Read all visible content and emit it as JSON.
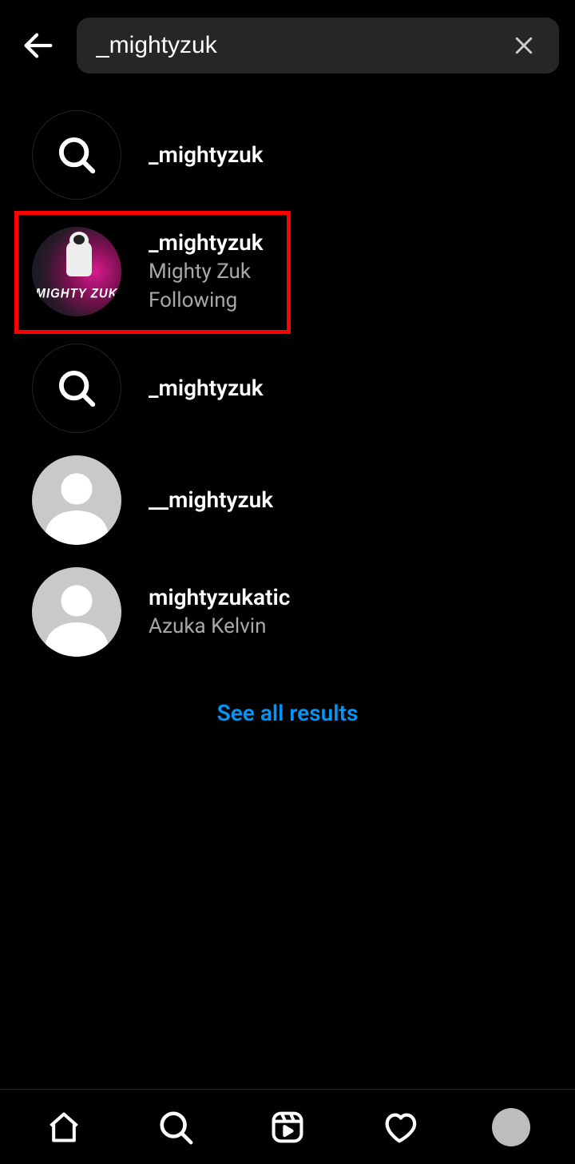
{
  "search": {
    "query": "_mightyzuk"
  },
  "results": [
    {
      "type": "query",
      "username": "_mightyzuk",
      "display_name": "",
      "status": ""
    },
    {
      "type": "profile",
      "username": "_mightyzuk",
      "display_name": "Mighty Zuk",
      "status": "Following",
      "avatar": "custom",
      "highlighted": true,
      "avatar_text": "MIGHTY ZUK"
    },
    {
      "type": "query",
      "username": "_mightyzuk",
      "display_name": "",
      "status": ""
    },
    {
      "type": "profile",
      "username": "__mightyzuk",
      "display_name": "",
      "status": "",
      "avatar": "default"
    },
    {
      "type": "profile",
      "username": "mightyzukatic",
      "display_name": "Azuka Kelvin",
      "status": "",
      "avatar": "default"
    }
  ],
  "see_all_label": "See all results"
}
